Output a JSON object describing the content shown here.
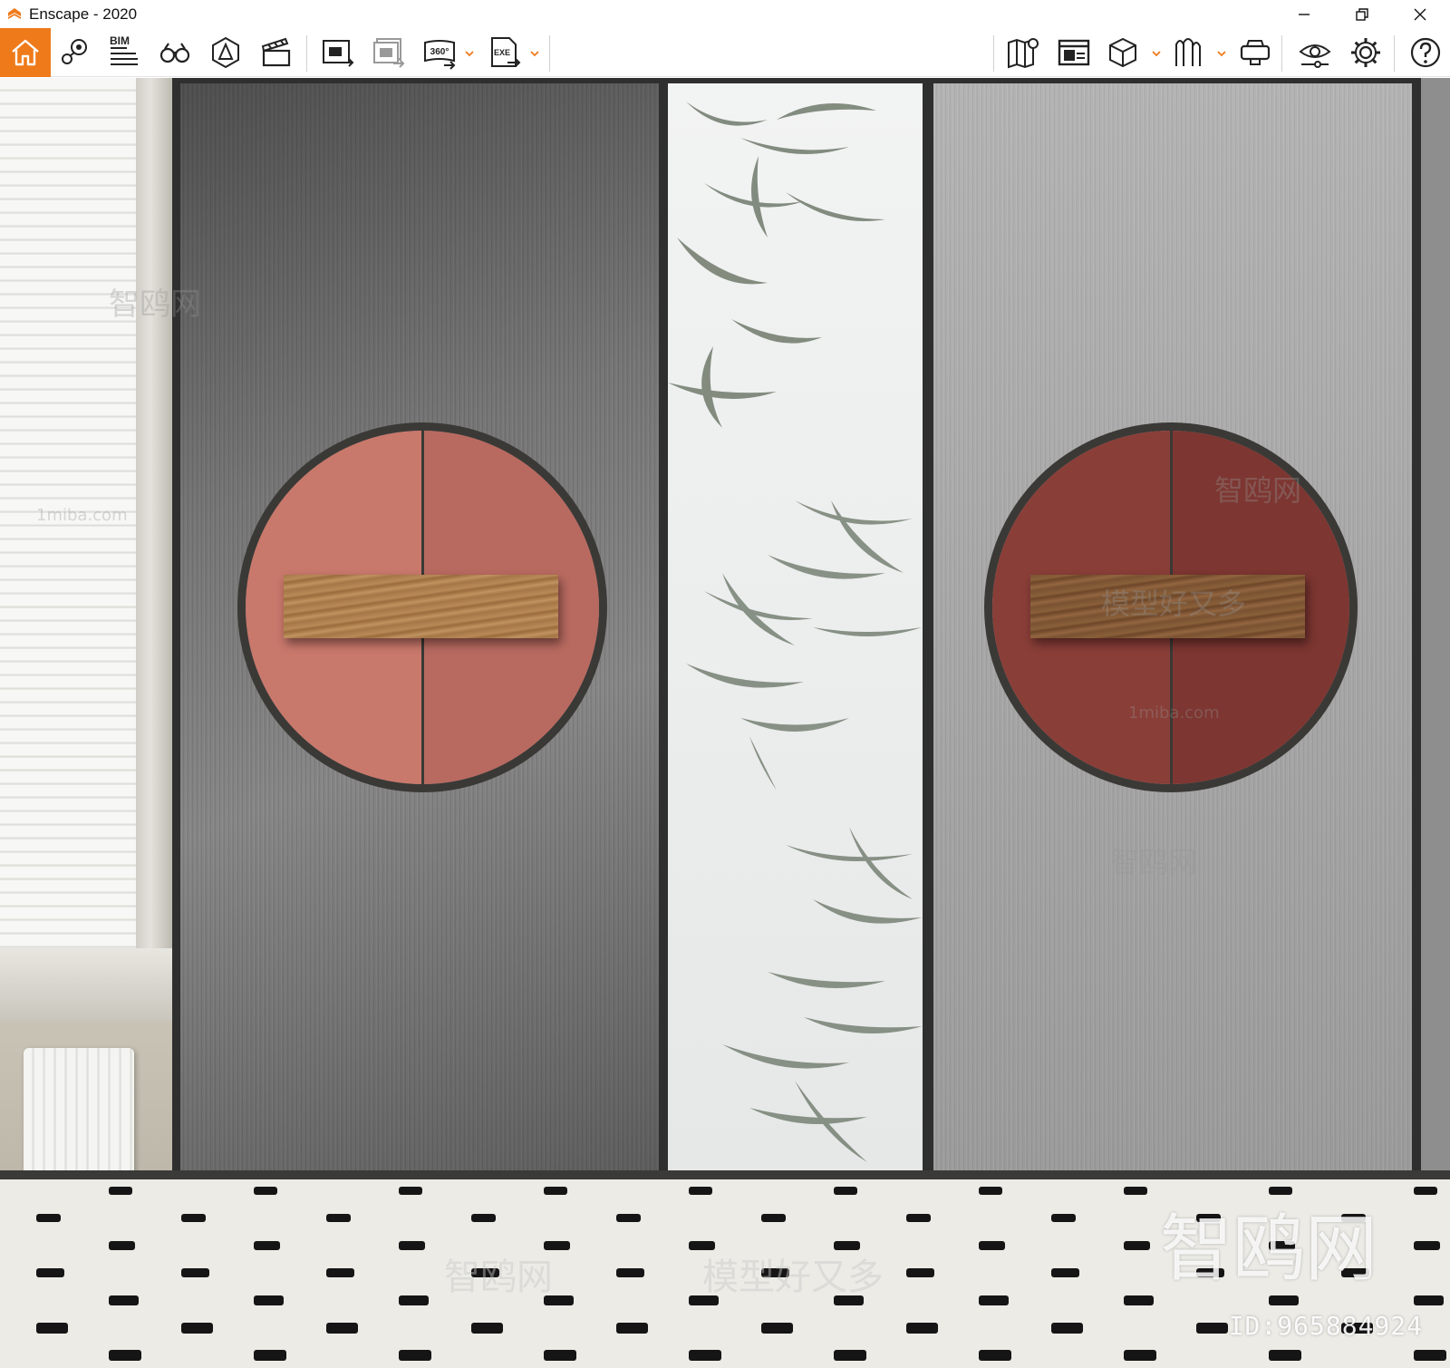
{
  "window": {
    "title": "Enscape - 2020",
    "controls": [
      "minimize",
      "restore",
      "close"
    ]
  },
  "toolbar": {
    "left_tools": [
      {
        "icon": "home-icon",
        "active": true
      },
      {
        "icon": "views-pin-icon"
      },
      {
        "icon": "bim-icon",
        "label": "BIM"
      },
      {
        "icon": "binoculars-icon"
      },
      {
        "icon": "atmosphere-icon"
      },
      {
        "icon": "video-editor-icon"
      },
      {
        "icon": "screenshot-icon"
      },
      {
        "icon": "batch-render-icon"
      },
      {
        "icon": "panorama-360-icon",
        "label": "360°"
      },
      {
        "icon": "export-exe-icon",
        "label": "EXE"
      }
    ],
    "right_tools": [
      {
        "icon": "map-icon"
      },
      {
        "icon": "web-standalone-icon"
      },
      {
        "icon": "cube-icon"
      },
      {
        "icon": "asset-library-icon"
      },
      {
        "icon": "vr-headset-icon"
      },
      {
        "icon": "visual-settings-icon"
      },
      {
        "icon": "settings-icon"
      },
      {
        "icon": "help-icon"
      }
    ],
    "accent_color": "#ef7a1a"
  },
  "scene": {
    "left_circle_colors": [
      "#c9786c",
      "#b86a60"
    ],
    "right_circle_colors": [
      "#8a3e38",
      "#7d3631"
    ]
  },
  "watermarks": {
    "brand": "智鸥网",
    "slogan": "模型好又多",
    "site": "1miba.com",
    "id_label": "ID:965884924"
  }
}
